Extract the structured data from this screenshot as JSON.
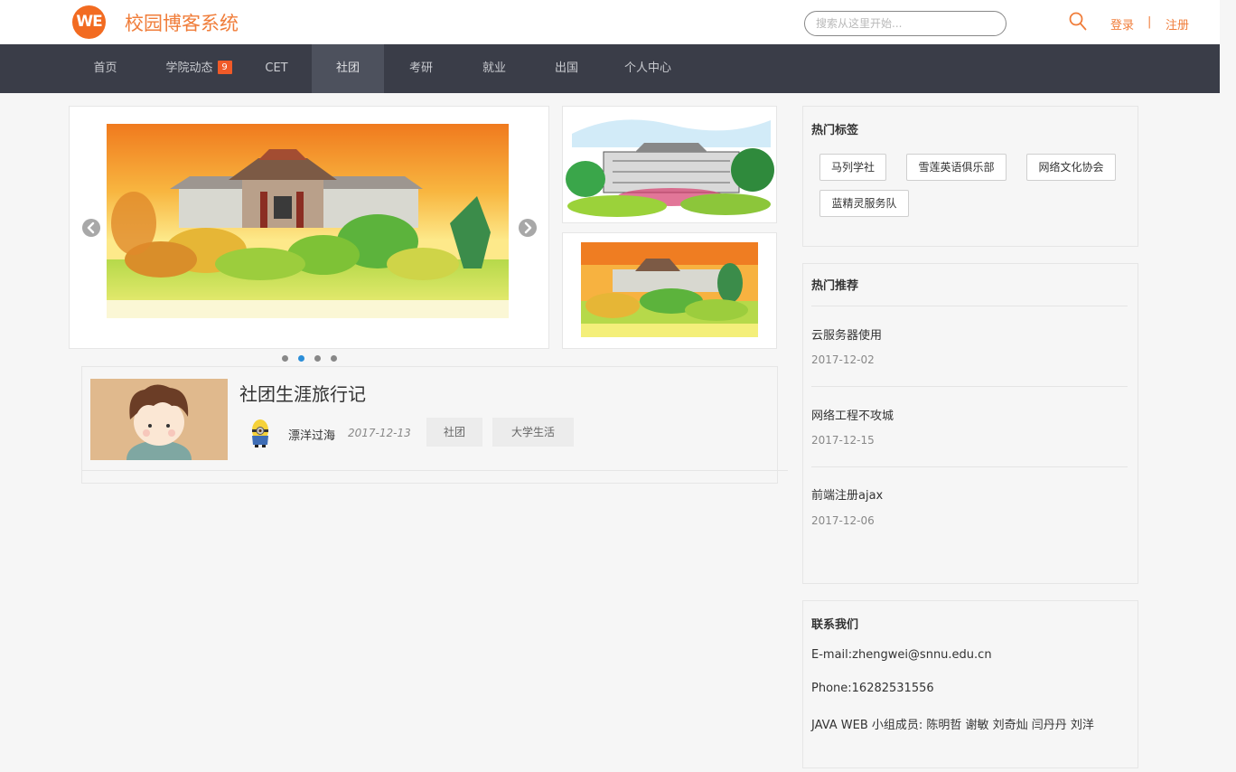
{
  "header": {
    "logo_text": "WE",
    "site_title": "校园博客系统",
    "search_placeholder": "搜索从这里开始...",
    "login_label": "登录",
    "separator": "|",
    "register_label": "注册"
  },
  "nav": {
    "items": [
      {
        "label": "首页"
      },
      {
        "label": "学院动态",
        "badge": "9"
      },
      {
        "label": "CET"
      },
      {
        "label": "社团",
        "active": true
      },
      {
        "label": "考研"
      },
      {
        "label": "就业"
      },
      {
        "label": "出国"
      },
      {
        "label": "个人中心"
      }
    ]
  },
  "carousel": {
    "slide_count": 4,
    "active_index": 1,
    "prev_icon": "chevron-left-icon",
    "next_icon": "chevron-right-icon"
  },
  "article": {
    "title": "社团生涯旅行记",
    "author": "漂洋过海",
    "date": "2017-12-13",
    "tags": [
      "社团",
      "大学生活"
    ]
  },
  "sidebar": {
    "hot_tags": {
      "title": "热门标签",
      "tags": [
        "马列学社",
        "雪莲英语俱乐部",
        "网络文化协会",
        "蓝精灵服务队"
      ]
    },
    "hot_recommend": {
      "title": "热门推荐",
      "items": [
        {
          "title": "云服务器使用",
          "date": "2017-12-02"
        },
        {
          "title": "网络工程不攻城",
          "date": "2017-12-15"
        },
        {
          "title": "前端注册ajax",
          "date": "2017-12-06"
        }
      ]
    },
    "contact": {
      "title": "联系我们",
      "email": "E-mail:zhengwei@snnu.edu.cn",
      "phone": "Phone:16282531556",
      "members": "JAVA WEB 小组成员: 陈明哲 谢敏 刘奇灿 闫丹丹 刘洋"
    }
  },
  "colors": {
    "accent": "#f07d3a",
    "nav_bg": "#3a3d48",
    "nav_active_bg": "#4d515d",
    "badge": "#f05a28",
    "dot_active": "#2b8ed8"
  }
}
